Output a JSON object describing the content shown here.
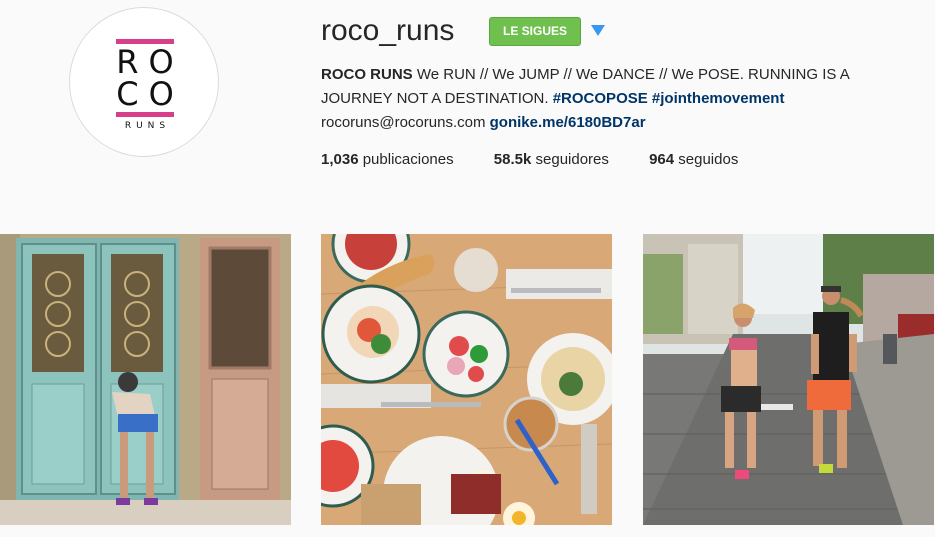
{
  "profile": {
    "username": "roco_runs",
    "follow_label": "LE SIGUES",
    "avatar_logo": {
      "line1": "RO",
      "line2": "CO",
      "sub": "RUNS"
    },
    "bio": {
      "name": "ROCO RUNS",
      "text": "We RUN // We JUMP // We DANCE // We POSE. RUNNING IS A JOURNEY NOT A DESTINATION.",
      "hashtag1": "#ROCOPOSE",
      "hashtag2": "#jointhemovement",
      "email": "rocoruns@rocoruns.com",
      "link": "gonike.me/6180BD7ar"
    },
    "stats": {
      "posts_count": "1,036",
      "posts_label": "publicaciones",
      "followers_count": "58.5k",
      "followers_label": "seguidores",
      "following_count": "964",
      "following_label": "seguidos"
    }
  },
  "colors": {
    "follow_button": "#70c050",
    "link": "#003569",
    "logo_accent": "#d6408a",
    "dropdown_arrow": "#3897f0"
  },
  "icons": {
    "dropdown": "triangle-down-icon"
  }
}
